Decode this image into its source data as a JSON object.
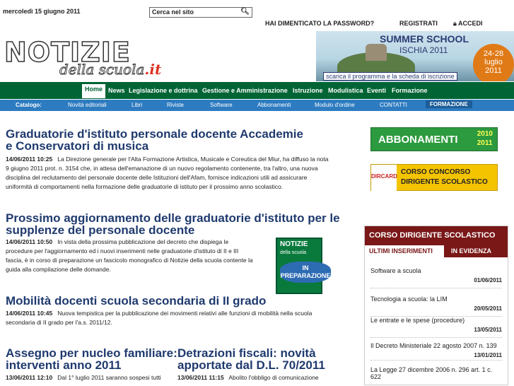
{
  "top": {
    "date": "mercoledì 15 giugno 2011",
    "search_placeholder": "Cerca nel sito",
    "forgot": "HAI DIMENTICATO LA PASSWORD?",
    "register": "REGISTRATI",
    "login": "ACCEDI"
  },
  "logo": {
    "main": "NOTIZIE",
    "sub": "della scuola",
    "tld": ".it"
  },
  "banner": {
    "title": "SUMMER SCHOOL",
    "subtitle": "ISCHIA 2011",
    "dates": [
      "24-28",
      "luglio",
      "2011"
    ],
    "link": "scarica il programma e la scheda di iscrizione"
  },
  "nav": [
    "Home",
    "News",
    "Legislazione e dottrina",
    "Gestione e Amministrazione",
    "Istruzione",
    "Modulistica",
    "Eventi",
    "Formazione"
  ],
  "catalog": {
    "label": "Catalogo:",
    "items": [
      "Novità editoriali",
      "Libri",
      "Riviste",
      "Software",
      "Abbonamenti",
      "Modulo d'ordine",
      "CONTATTI",
      "FORMAZIONE"
    ]
  },
  "articles": [
    {
      "title_line1": "Graduatorie d'istituto personale docente Accademie",
      "title_line2": "e Conservatori di musica",
      "date": "14/06/2011 10:25",
      "lines": [
        "La Direzione generale per l'Alta Formazione Artistica, Musicale e Coreutica del Miur, ha diffuso la nota",
        "9 giugno 2011 prot. n. 3154 che, in attesa dell'emanazione di un nuovo regolamento contenente, tra l'altro, una nuova",
        "disciplina del reclutamento del personale docente delle Istituzioni dell'Afam, fornisce indicazioni utili ad assicurare",
        "uniformità di comportamenti nella formazione delle graduatorie di istituto per il prossimo anno scolastico."
      ]
    },
    {
      "title_line1": "Prossimo aggiornamento delle graduatorie d'istituto per le",
      "title_line2": "supplenze del personale docente",
      "date": "14/06/2011 10:50",
      "lines": [
        "In vista della prossima pubblicazione del decreto che dispiega le",
        "procedure per l'aggiornamento ed i nuovi inserimenti nelle graduatorie d'istituto di II e III",
        "fascia, è in corso di preparazione un fascicolo monografico di Notizie della scuola contente la",
        "guida alla compilazione delle domande."
      ]
    },
    {
      "title_line1": "Mobilità docenti scuola secondaria di II grado",
      "date": "14/06/2011 10:45",
      "lines": [
        "Nuova tempistica per la pubblicazione dei movimenti relativi alle funzioni di mobilità nella scuola",
        "secondaria di II grado per l'a.s. 2011/12."
      ]
    },
    {
      "title_line1": "Assegno per nucleo familiare:",
      "title_line2": "interventi anno 2011",
      "date": "13/06/2011 12:10",
      "text": "Dal 1° luglio 2011 saranno sospesi tutti"
    },
    {
      "title_line1": "Detrazioni fiscali: novità",
      "title_line2": "apportate dal D.L. 70/2011",
      "date": "13/06/2011 11:15",
      "text": "Abolito l'obbligo di comunicazione"
    }
  ],
  "book": {
    "title": "NOTIZIE",
    "sub": "della scuola",
    "badge_line1": "IN",
    "badge_line2": "PREPARAZIONE"
  },
  "side": {
    "abbonamenti": "ABBONAMENTI",
    "abb_years": [
      "2010",
      "2011"
    ],
    "dircard": "DIRCARD",
    "dir_line1": "CORSO CONCORSO",
    "dir_line2": "DIRIGENTE SCOLASTICO"
  },
  "panel": {
    "title": "CORSO DIRIGENTE SCOLASTICO",
    "tab_active": "ULTIMI INSERIMENTI",
    "tab_other": "IN EVIDENZA",
    "items": [
      {
        "text": "Software a scuola",
        "date": "01/06/2011"
      },
      {
        "text": "Tecnologia a scuola: la LIM",
        "date": "20/05/2011"
      },
      {
        "text": "Le entrate e le spese (procedure)",
        "date": "13/05/2011"
      },
      {
        "text": "Il Decreto Ministeriale 22 agosto 2007 n. 139",
        "date": "13/01/2011"
      },
      {
        "text": "La Legge 27 dicembre 2006 n. 296 art. 1 c.",
        "text2": "622"
      }
    ]
  }
}
